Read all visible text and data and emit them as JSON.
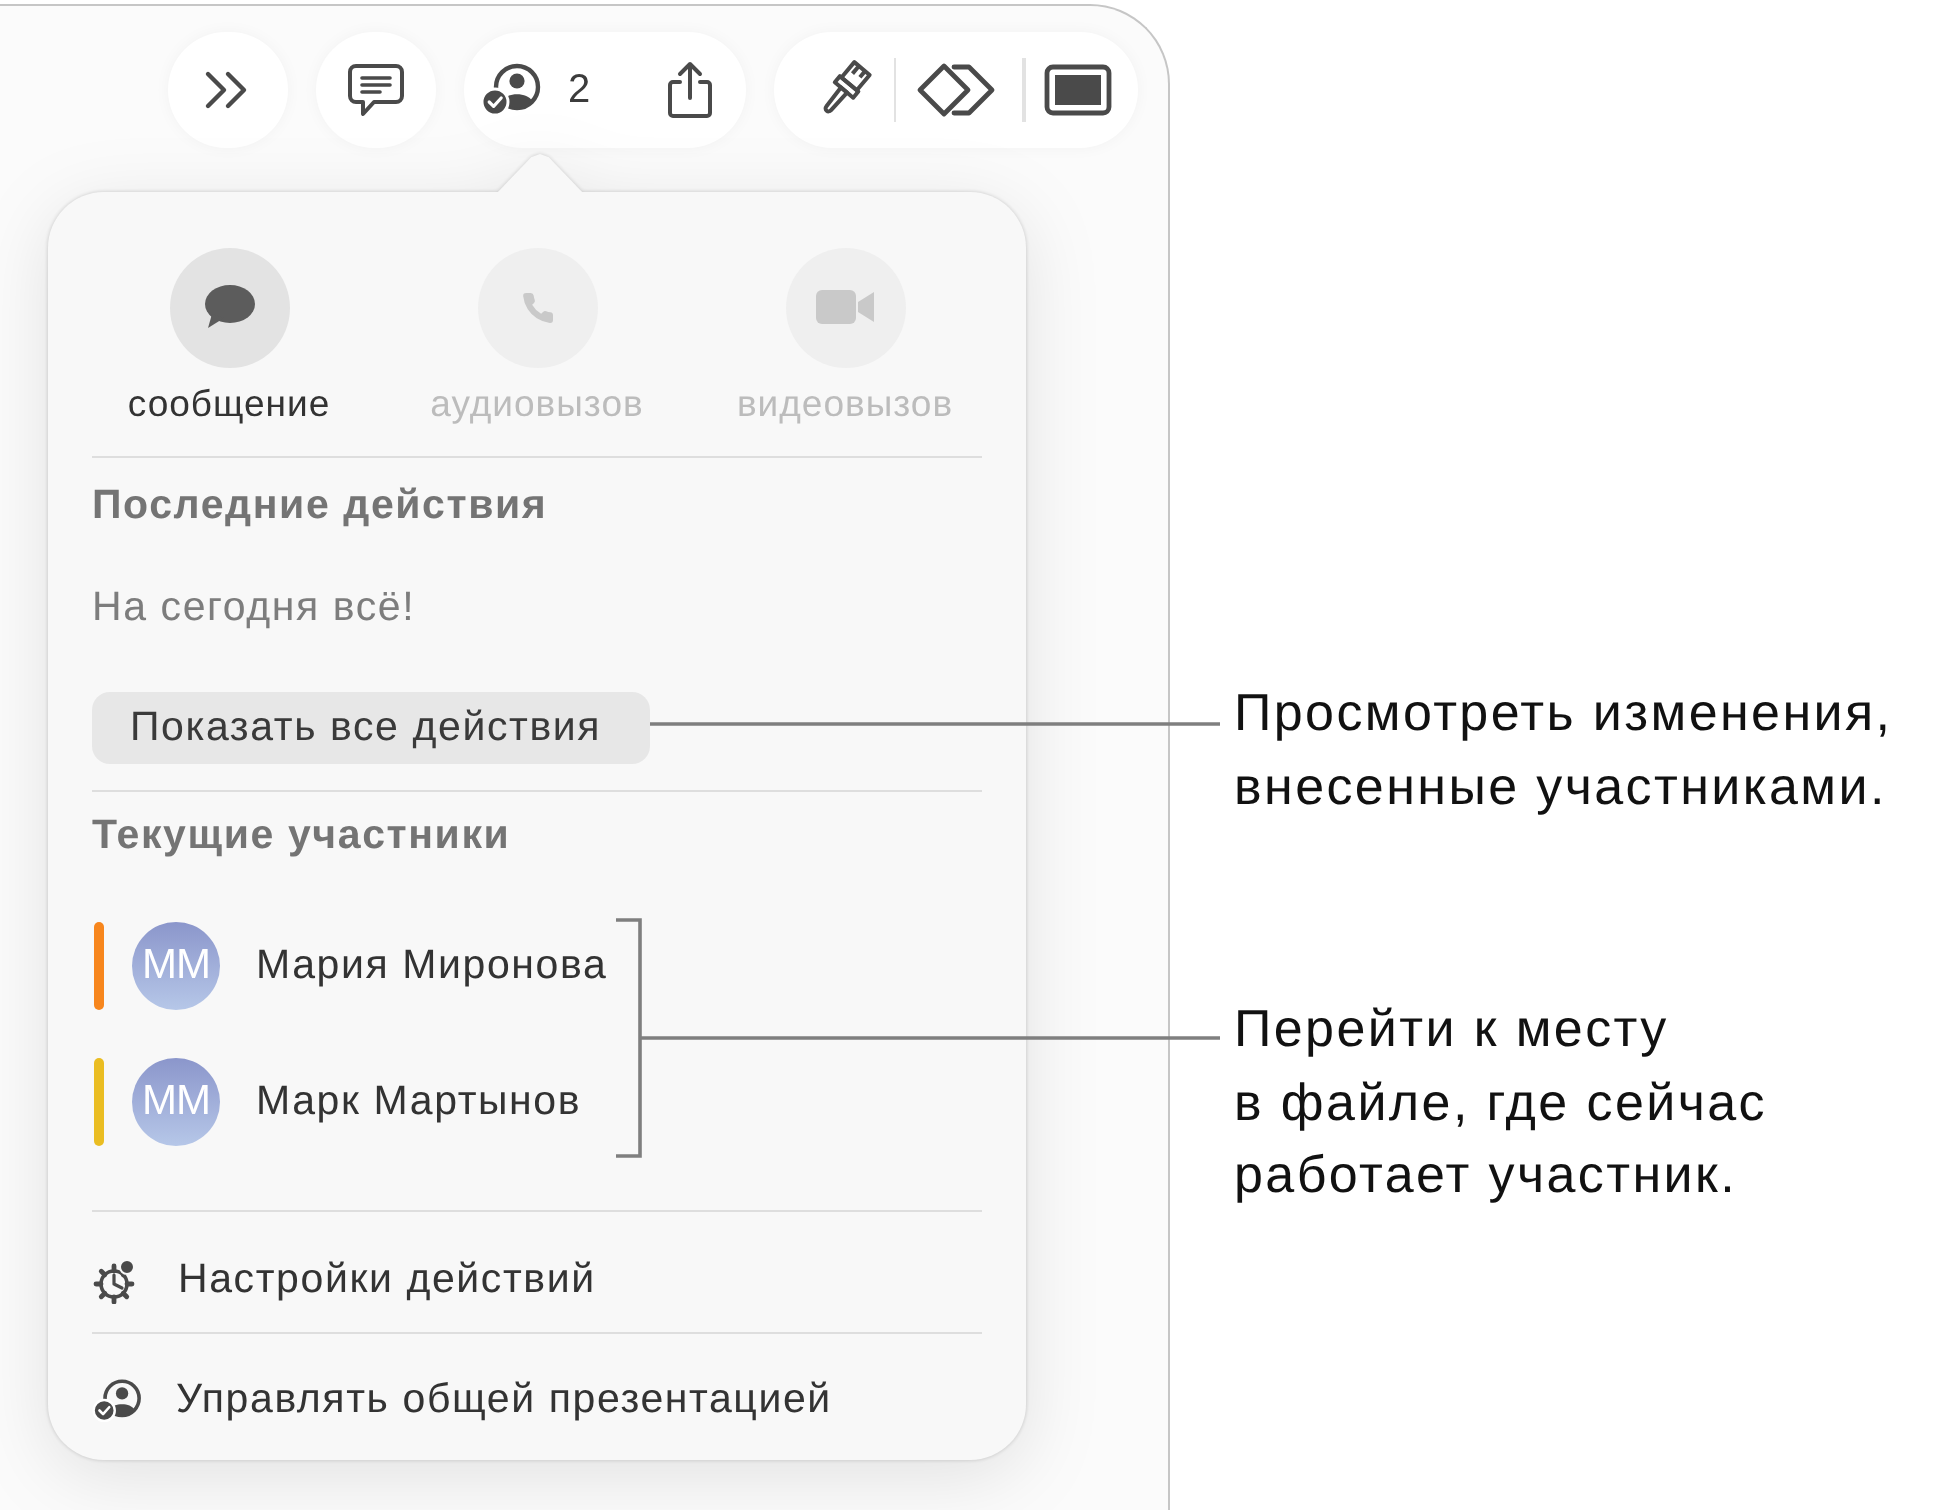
{
  "toolbar": {
    "collaboration_count": "2"
  },
  "popover": {
    "contact_actions": [
      {
        "kind": "message",
        "label": "сообщение",
        "disabled": false
      },
      {
        "kind": "audio",
        "label": "аудиовызов",
        "disabled": true
      },
      {
        "kind": "video",
        "label": "видеовызов",
        "disabled": true
      }
    ],
    "recent_activity": {
      "heading": "Последние действия",
      "message": "На сегодня всё!",
      "button": "Показать все действия"
    },
    "participants": {
      "heading": "Текущие участники",
      "people": [
        {
          "initials": "ММ",
          "name": "Мария Миронова",
          "color": "#f7861d"
        },
        {
          "initials": "ММ",
          "name": "Марк Мартынов",
          "color": "#eabd22"
        }
      ]
    },
    "menu_items": [
      {
        "kind": "settings",
        "label": "Настройки действий"
      },
      {
        "kind": "manage",
        "label": "Управлять общей презентацией"
      }
    ]
  },
  "callouts": [
    {
      "lines": [
        "Просмотреть изменения,",
        "внесенные участниками."
      ]
    },
    {
      "lines": [
        "Перейти к месту",
        "в файле, где сейчас",
        "работает участник."
      ]
    }
  ]
}
